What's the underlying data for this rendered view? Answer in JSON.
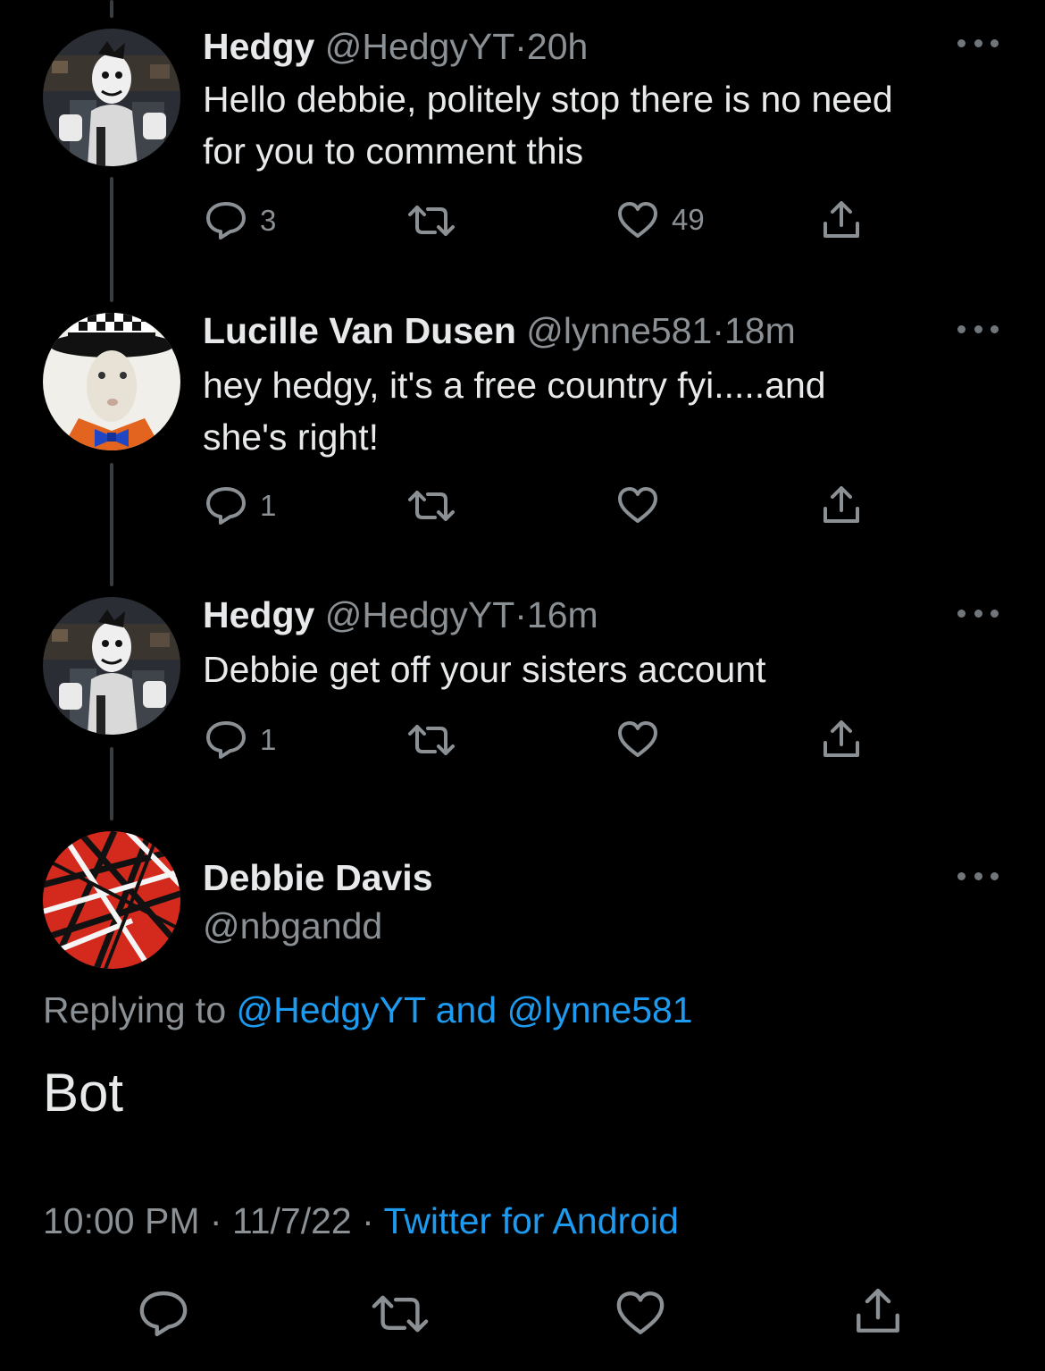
{
  "replies": [
    {
      "display_name": "Hedgy",
      "handle": "@HedgyYT",
      "time": "20h",
      "text_line1": "Hello debbie, politely stop there is no need",
      "text_line2": "for you to comment this",
      "reply_count": "3",
      "retweet_count": "",
      "like_count": "49",
      "avatar": "clown-avatar"
    },
    {
      "display_name": "Lucille Van Dusen",
      "handle": "@lynne581",
      "time": "18m",
      "text_line1": "hey hedgy, it's a free country fyi.....and",
      "text_line2": "she's right!",
      "reply_count": "1",
      "retweet_count": "",
      "like_count": "",
      "avatar": "rabbit-avatar"
    },
    {
      "display_name": "Hedgy",
      "handle": "@HedgyYT",
      "time": "16m",
      "text_line1": "Debbie get off your sisters account",
      "reply_count": "1",
      "retweet_count": "",
      "like_count": "",
      "avatar": "clown-avatar"
    }
  ],
  "main_tweet": {
    "display_name": "Debbie Davis",
    "handle": "@nbgandd",
    "replying_prefix": "Replying to",
    "replying_user1": "@HedgyYT",
    "replying_and": "and",
    "replying_user2": "@lynne581",
    "text": "Bot",
    "time": "10:00 PM",
    "date": "11/7/22",
    "source": "Twitter for Android",
    "separator": "·",
    "avatar": "red-stripes-avatar"
  },
  "icons": [
    "reply-icon",
    "retweet-icon",
    "like-icon",
    "share-icon",
    "more-icon"
  ],
  "colors": {
    "background": "#000000",
    "text": "#e7e9ea",
    "secondary": "#8b9095",
    "link": "#1d9bf0",
    "thread_line": "#3a3d40"
  }
}
